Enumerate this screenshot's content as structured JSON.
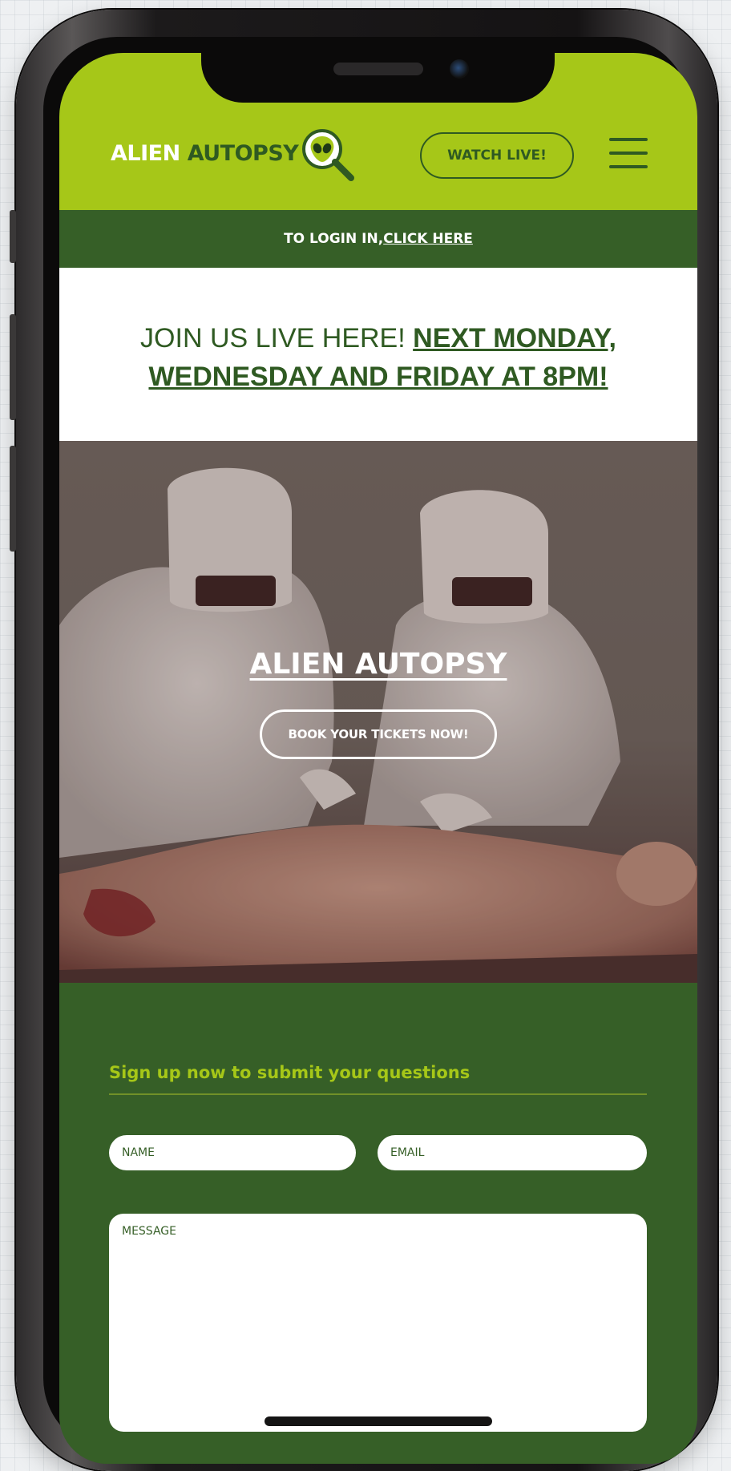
{
  "header": {
    "logo_word_1": "ALIEN",
    "logo_word_2": "AUTOPSY",
    "logo_icon": "alien-magnifier-icon",
    "watch_live_label": "WATCH LIVE!",
    "menu_icon": "hamburger-menu-icon"
  },
  "login_bar": {
    "prefix": "TO LOGIN IN, ",
    "link_label": "CLICK HERE"
  },
  "announcement": {
    "text": "JOIN US LIVE HERE! ",
    "link_text": "NEXT MONDAY, WEDNESDAY AND FRIDAY AT 8PM!"
  },
  "hero": {
    "title": "ALIEN AUTOPSY",
    "cta_label": "BOOK YOUR TICKETS NOW!"
  },
  "form": {
    "heading": "Sign up now to submit your questions",
    "name_placeholder": "NAME",
    "email_placeholder": "EMAIL",
    "message_placeholder": "MESSAGE"
  },
  "colors": {
    "lime": "#a6c718",
    "dark_green": "#365f27",
    "text_green": "#2f5a22",
    "white": "#ffffff"
  }
}
